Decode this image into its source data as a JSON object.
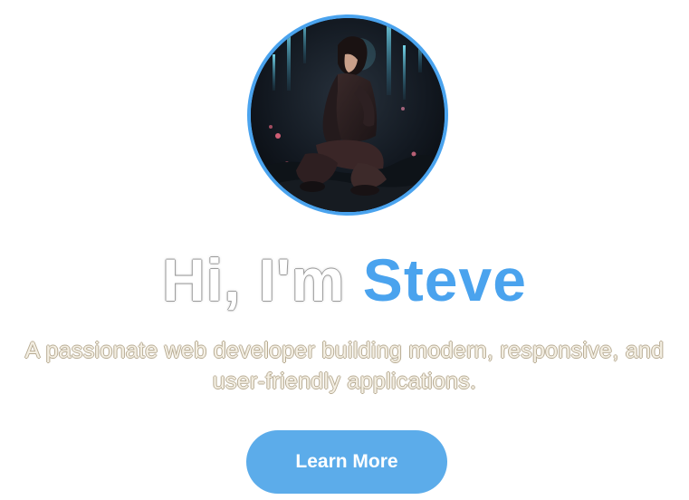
{
  "hero": {
    "avatar_alt": "Profile picture",
    "headline_greeting": "Hi, I'm ",
    "headline_name": "Steve",
    "tagline": "A passionate web developer building modern, responsive, and user-friendly applications.",
    "cta_label": "Learn More"
  },
  "colors": {
    "accent": "#4aa3ee",
    "button": "#5cacea",
    "tagline_text": "#f4efe3"
  }
}
